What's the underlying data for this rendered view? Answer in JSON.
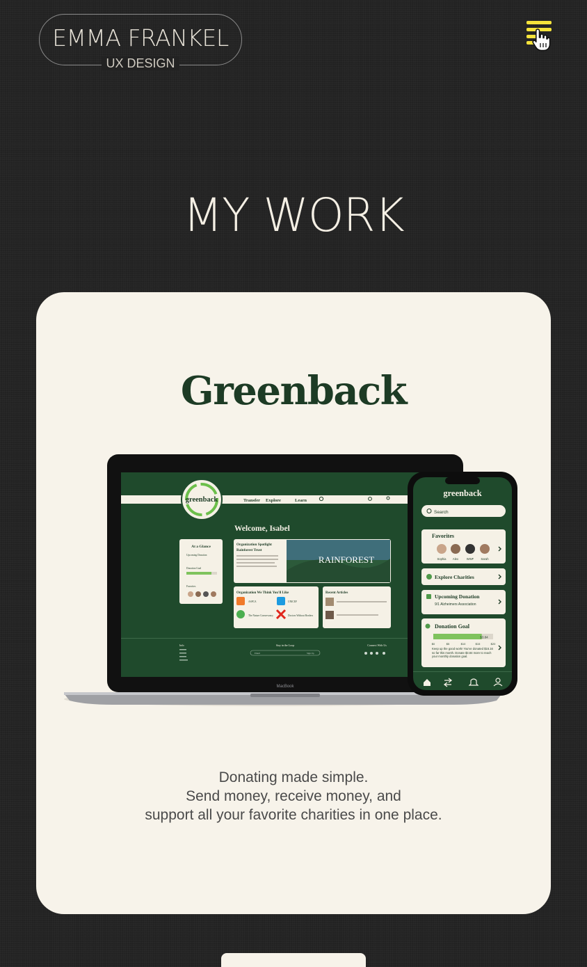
{
  "header": {
    "logo_name": "EMMA FRANKEL",
    "logo_sub": "UX DESIGN",
    "menu_icon": "hamburger-menu-icon",
    "cursor_icon": "hand-pointer-icon"
  },
  "section": {
    "title": "MY WORK"
  },
  "project": {
    "title": "Greenback",
    "description": [
      "Donating made simple.",
      "Send money, receive money, and",
      "support all your favorite charities in one place."
    ],
    "laptop": {
      "brand": "greenback",
      "nav": [
        "Transfer",
        "Explore",
        "Learn"
      ],
      "welcome": "Welcome, Isabel",
      "glance_title": "At a Glance",
      "glance_items": [
        "Upcoming Donation",
        "Donation Goal",
        "Favorites"
      ],
      "spotlight_title": "Organization Spotlight",
      "spotlight_org": "Rainforest Trust",
      "spotlight_image_text": "RAINFOREST",
      "orgs_title": "Organization We Think You'll Like",
      "orgs": [
        "ASPCA",
        "UNICEF",
        "The Nature Conservancy",
        "Doctors Without Borders"
      ],
      "articles_title": "Recent Articles",
      "footer_info": "Info",
      "footer_loop": "Stay in the Loop",
      "footer_connect": "Connect With Us",
      "footer_signup": "Sign Up",
      "footer_email": "Email",
      "laptop_label": "MacBook"
    },
    "phone": {
      "brand": "greenback",
      "search": "Search",
      "favorites": "Favorites",
      "favorite_names": [
        "Sophia",
        "Alex",
        "WWF",
        "Sarah"
      ],
      "explore": "Explore Charities",
      "upcoming": "Upcoming Donation",
      "upcoming_detail": "9/1 Alzheimers Association",
      "goal": "Donation Goal",
      "goal_amount": "$3.84",
      "goal_ticks": [
        "$0",
        "$5",
        "$10",
        "$15",
        "$20"
      ],
      "goal_note": "Keep up the good work! You've donated $16.16 so far this month. Donate $3.84 more to reach your monthly donation goal.",
      "goal_progress": 0.81
    }
  },
  "colors": {
    "page_bg": "#222222",
    "card_bg": "#f7f3ea",
    "brand_green": "#1d3b25",
    "accent_yellow": "#f5e33b"
  }
}
